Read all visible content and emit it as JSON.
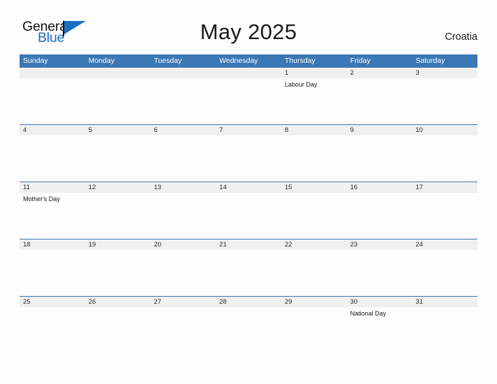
{
  "brand": {
    "name_part1": "General",
    "name_part2": "Blue",
    "accent_color": "#1b6ec2"
  },
  "header": {
    "title": "May 2025",
    "country": "Croatia"
  },
  "calendar": {
    "header_color": "#3b78b5",
    "band_color": "#f0f0f0",
    "weekdays": [
      "Sunday",
      "Monday",
      "Tuesday",
      "Wednesday",
      "Thursday",
      "Friday",
      "Saturday"
    ],
    "weeks": [
      [
        {
          "date": "",
          "events": []
        },
        {
          "date": "",
          "events": []
        },
        {
          "date": "",
          "events": []
        },
        {
          "date": "",
          "events": []
        },
        {
          "date": "1",
          "events": [
            "Labour Day"
          ]
        },
        {
          "date": "2",
          "events": []
        },
        {
          "date": "3",
          "events": []
        }
      ],
      [
        {
          "date": "4",
          "events": []
        },
        {
          "date": "5",
          "events": []
        },
        {
          "date": "6",
          "events": []
        },
        {
          "date": "7",
          "events": []
        },
        {
          "date": "8",
          "events": []
        },
        {
          "date": "9",
          "events": []
        },
        {
          "date": "10",
          "events": []
        }
      ],
      [
        {
          "date": "11",
          "events": [
            "Mother's Day"
          ]
        },
        {
          "date": "12",
          "events": []
        },
        {
          "date": "13",
          "events": []
        },
        {
          "date": "14",
          "events": []
        },
        {
          "date": "15",
          "events": []
        },
        {
          "date": "16",
          "events": []
        },
        {
          "date": "17",
          "events": []
        }
      ],
      [
        {
          "date": "18",
          "events": []
        },
        {
          "date": "19",
          "events": []
        },
        {
          "date": "20",
          "events": []
        },
        {
          "date": "21",
          "events": []
        },
        {
          "date": "22",
          "events": []
        },
        {
          "date": "23",
          "events": []
        },
        {
          "date": "24",
          "events": []
        }
      ],
      [
        {
          "date": "25",
          "events": []
        },
        {
          "date": "26",
          "events": []
        },
        {
          "date": "27",
          "events": []
        },
        {
          "date": "28",
          "events": []
        },
        {
          "date": "29",
          "events": []
        },
        {
          "date": "30",
          "events": [
            "National Day"
          ]
        },
        {
          "date": "31",
          "events": []
        }
      ]
    ]
  }
}
